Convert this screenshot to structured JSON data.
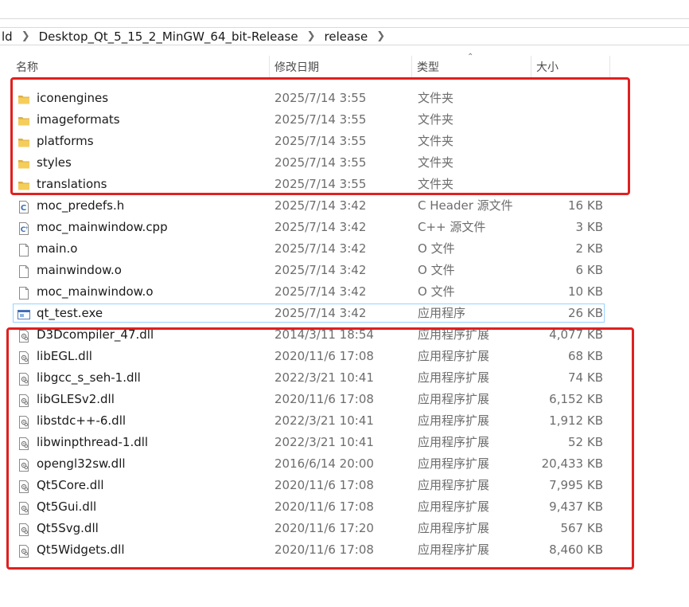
{
  "breadcrumb": [
    "ld",
    "Desktop_Qt_5_15_2_MinGW_64_bit-Release",
    "release"
  ],
  "columns": {
    "name": "名称",
    "date": "修改日期",
    "type": "类型",
    "size": "大小"
  },
  "files": [
    {
      "name": "iconengines",
      "date": "2025/7/14 3:55",
      "type": "文件夹",
      "size": "",
      "icon": "folder-icon"
    },
    {
      "name": "imageformats",
      "date": "2025/7/14 3:55",
      "type": "文件夹",
      "size": "",
      "icon": "folder-icon"
    },
    {
      "name": "platforms",
      "date": "2025/7/14 3:55",
      "type": "文件夹",
      "size": "",
      "icon": "folder-icon"
    },
    {
      "name": "styles",
      "date": "2025/7/14 3:55",
      "type": "文件夹",
      "size": "",
      "icon": "folder-icon"
    },
    {
      "name": "translations",
      "date": "2025/7/14 3:55",
      "type": "文件夹",
      "size": "",
      "icon": "folder-icon"
    },
    {
      "name": "moc_predefs.h",
      "date": "2025/7/14 3:42",
      "type": "C Header 源文件",
      "size": "16 KB",
      "icon": "c-header-file-icon"
    },
    {
      "name": "moc_mainwindow.cpp",
      "date": "2025/7/14 3:42",
      "type": "C++ 源文件",
      "size": "3 KB",
      "icon": "cpp-file-icon"
    },
    {
      "name": "main.o",
      "date": "2025/7/14 3:42",
      "type": "O 文件",
      "size": "2 KB",
      "icon": "blank-file-icon"
    },
    {
      "name": "mainwindow.o",
      "date": "2025/7/14 3:42",
      "type": "O 文件",
      "size": "6 KB",
      "icon": "blank-file-icon"
    },
    {
      "name": "moc_mainwindow.o",
      "date": "2025/7/14 3:42",
      "type": "O 文件",
      "size": "10 KB",
      "icon": "blank-file-icon"
    },
    {
      "name": "qt_test.exe",
      "date": "2025/7/14 3:42",
      "type": "应用程序",
      "size": "26 KB",
      "icon": "exe-file-icon",
      "selected": true
    },
    {
      "name": "D3Dcompiler_47.dll",
      "date": "2014/3/11 18:54",
      "type": "应用程序扩展",
      "size": "4,077 KB",
      "icon": "dll-file-icon"
    },
    {
      "name": "libEGL.dll",
      "date": "2020/11/6 17:08",
      "type": "应用程序扩展",
      "size": "68 KB",
      "icon": "dll-file-icon"
    },
    {
      "name": "libgcc_s_seh-1.dll",
      "date": "2022/3/21 10:41",
      "type": "应用程序扩展",
      "size": "74 KB",
      "icon": "dll-file-icon"
    },
    {
      "name": "libGLESv2.dll",
      "date": "2020/11/6 17:08",
      "type": "应用程序扩展",
      "size": "6,152 KB",
      "icon": "dll-file-icon"
    },
    {
      "name": "libstdc++-6.dll",
      "date": "2022/3/21 10:41",
      "type": "应用程序扩展",
      "size": "1,912 KB",
      "icon": "dll-file-icon"
    },
    {
      "name": "libwinpthread-1.dll",
      "date": "2022/3/21 10:41",
      "type": "应用程序扩展",
      "size": "52 KB",
      "icon": "dll-file-icon"
    },
    {
      "name": "opengl32sw.dll",
      "date": "2016/6/14 20:00",
      "type": "应用程序扩展",
      "size": "20,433 KB",
      "icon": "dll-file-icon"
    },
    {
      "name": "Qt5Core.dll",
      "date": "2020/11/6 17:08",
      "type": "应用程序扩展",
      "size": "7,995 KB",
      "icon": "dll-file-icon"
    },
    {
      "name": "Qt5Gui.dll",
      "date": "2020/11/6 17:08",
      "type": "应用程序扩展",
      "size": "9,437 KB",
      "icon": "dll-file-icon"
    },
    {
      "name": "Qt5Svg.dll",
      "date": "2020/11/6 17:20",
      "type": "应用程序扩展",
      "size": "567 KB",
      "icon": "dll-file-icon"
    },
    {
      "name": "Qt5Widgets.dll",
      "date": "2020/11/6 17:08",
      "type": "应用程序扩展",
      "size": "8,460 KB",
      "icon": "dll-file-icon"
    }
  ],
  "colors": {
    "highlight_box": "#e02020",
    "selection_border": "#99d1ff",
    "folder": "#f2c94c",
    "secondary_text": "#6d6d6d"
  }
}
